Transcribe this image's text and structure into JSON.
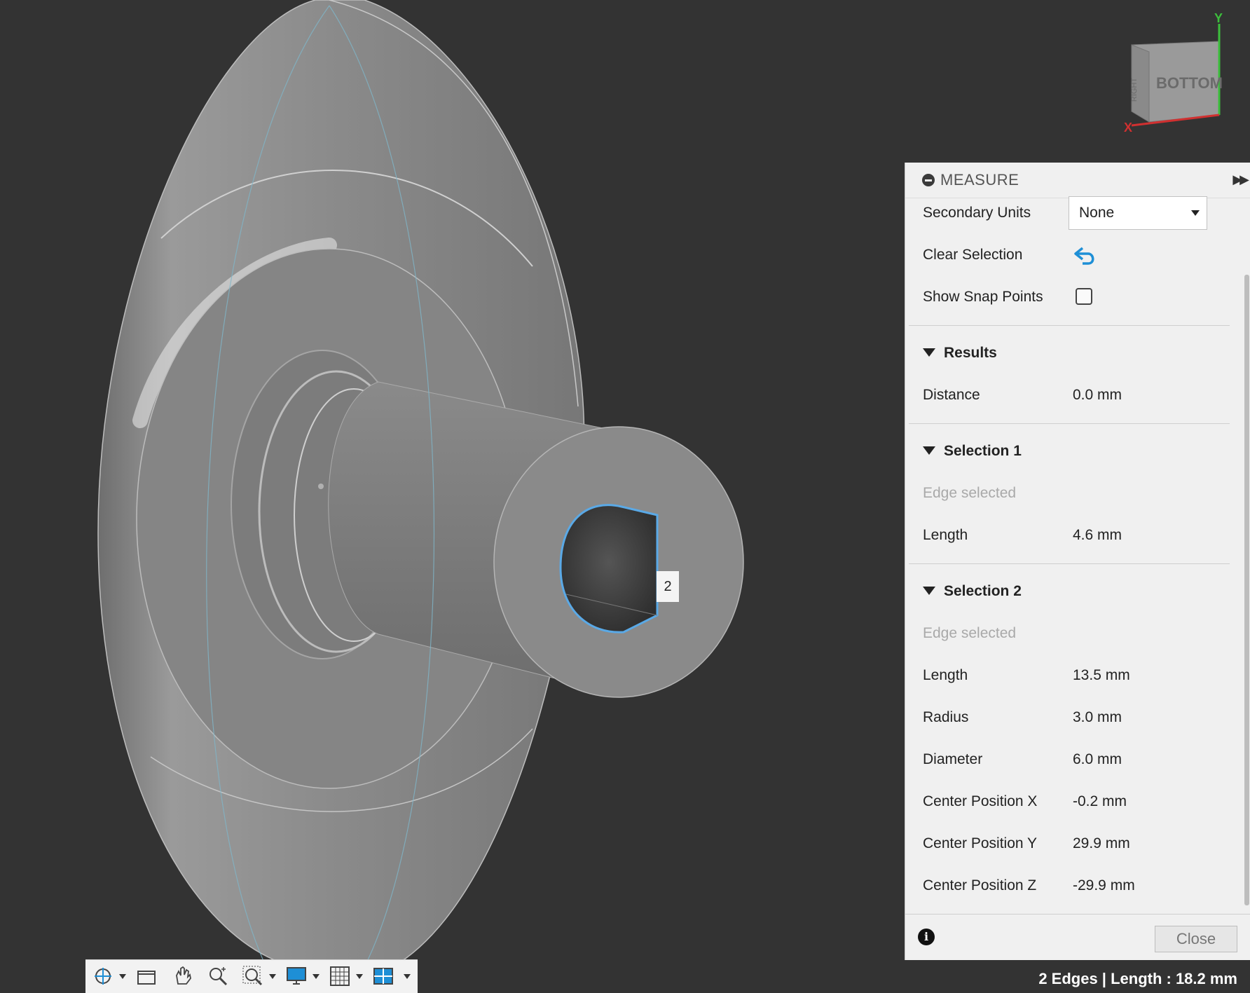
{
  "viewcube": {
    "face_label": "BOTTOM",
    "side_label": "RIGHT",
    "axis_x": "X",
    "axis_y": "Y"
  },
  "edge_tag": "2",
  "measure": {
    "title": "MEASURE",
    "secondary_units_label": "Secondary Units",
    "secondary_units_value": "None",
    "clear_selection_label": "Clear Selection",
    "show_snap_points_label": "Show Snap Points",
    "show_snap_points_checked": false,
    "results": {
      "title": "Results",
      "distance_label": "Distance",
      "distance_value": "0.0 mm"
    },
    "selection1": {
      "title": "Selection 1",
      "status": "Edge selected",
      "length_label": "Length",
      "length_value": "4.6 mm"
    },
    "selection2": {
      "title": "Selection 2",
      "status": "Edge selected",
      "rows": [
        {
          "label": "Length",
          "value": "13.5 mm"
        },
        {
          "label": "Radius",
          "value": "3.0 mm"
        },
        {
          "label": "Diameter",
          "value": "6.0 mm"
        },
        {
          "label": "Center Position X",
          "value": "-0.2 mm"
        },
        {
          "label": "Center Position Y",
          "value": "29.9 mm"
        },
        {
          "label": "Center Position Z",
          "value": "-29.9 mm"
        }
      ]
    },
    "close_label": "Close"
  },
  "toolbar": {
    "items": [
      "orbit-icon",
      "look-at-icon",
      "pan-icon",
      "zoom-icon",
      "fit-icon",
      "display-settings-icon",
      "grid-icon",
      "viewports-icon"
    ]
  },
  "status_text": "2 Edges | Length : 18.2 mm",
  "colors": {
    "background": "#333333",
    "panel": "#f0f0f0",
    "selection": "#5aa9e6",
    "undo_icon": "#1e8fd6"
  }
}
